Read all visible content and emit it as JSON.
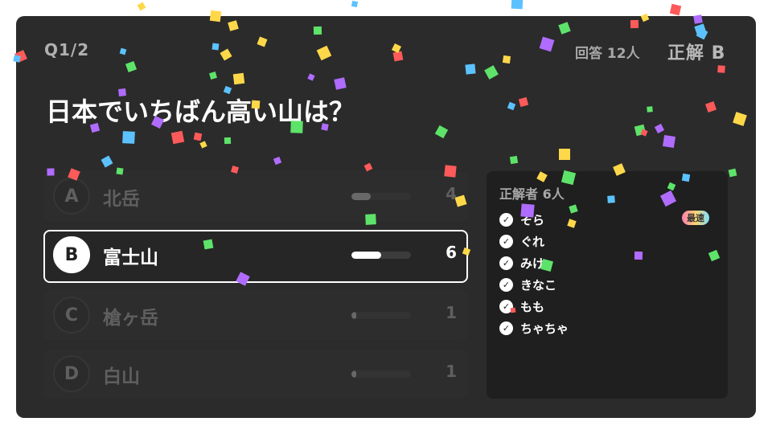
{
  "header": {
    "question_number": "Q1/2",
    "answer_count": "回答 12人",
    "correct_answer": "正解 B"
  },
  "question": {
    "text": "日本でいちばん高い山は？"
  },
  "choices": [
    {
      "letter": "A",
      "label": "北岳",
      "count": "4",
      "ratio": 0.33,
      "selected": false
    },
    {
      "letter": "B",
      "label": "富士山",
      "count": "6",
      "ratio": 0.5,
      "selected": true
    },
    {
      "letter": "C",
      "label": "槍ヶ岳",
      "count": "1",
      "ratio": 0.08,
      "selected": false
    },
    {
      "letter": "D",
      "label": "白山",
      "count": "1",
      "ratio": 0.08,
      "selected": false
    }
  ],
  "winners": {
    "title": "正解者 6人",
    "fastest_badge": "最速",
    "names": [
      "そら",
      "ぐれ",
      "みけ",
      "きなこ",
      "もも",
      "ちゃちゃ"
    ]
  },
  "colors": {
    "panel": "#2b2b2b",
    "confetti": [
      "#ffd84a",
      "#ff5a5a",
      "#5ee36a",
      "#5cc2ff",
      "#b06cff"
    ]
  }
}
